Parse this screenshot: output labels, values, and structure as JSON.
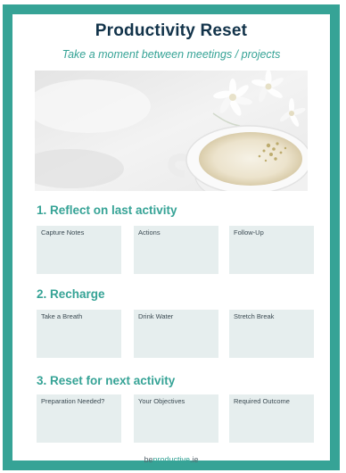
{
  "header": {
    "title": "Productivity Reset",
    "subtitle": "Take a moment between meetings / projects"
  },
  "sections": [
    {
      "heading": "1. Reflect on last activity",
      "boxes": [
        "Capture Notes",
        "Actions",
        "Follow-Up"
      ]
    },
    {
      "heading": "2. Recharge",
      "boxes": [
        "Take a Breath",
        "Drink Water",
        "Stretch Break"
      ]
    },
    {
      "heading": "3. Reset for next activity",
      "boxes": [
        "Preparation Needed?",
        "Your Objectives",
        "Required Outcome"
      ]
    }
  ],
  "footer": {
    "brand_prefix": "be",
    "brand_accent": "productive",
    "brand_suffix": ".ie"
  },
  "colors": {
    "border": "#36a396",
    "title": "#12334a",
    "accent": "#36a396",
    "box_fill": "#e6eeee"
  },
  "photo": {
    "icon": "coffee-cup-and-flowers-photo"
  }
}
